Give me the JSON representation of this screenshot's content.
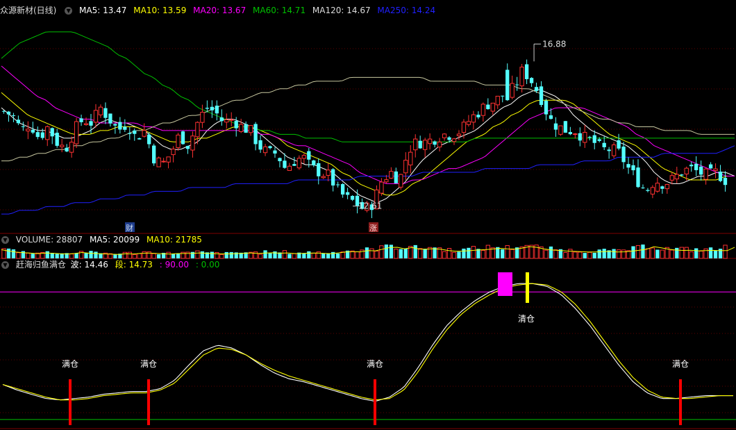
{
  "main_header": {
    "stock": "众源新材(日线)",
    "ma5": "MA5: 13.47",
    "ma10": "MA10: 13.59",
    "ma20": "MA20: 13.67",
    "ma60": "MA60: 14.71",
    "ma120": "MA120: 14.67",
    "ma250": "MA250: 14.24"
  },
  "vol_header": {
    "volume": "VOLUME: 28807",
    "ma5": "MA5: 20099",
    "ma10": "MA10: 21785"
  },
  "ind_header": {
    "name": "赶海归鱼满仓",
    "wave": "波: 14.46",
    "seg": "段: 14.73",
    "v90": ": 90.00",
    "v0": ": 0.00"
  },
  "colors": {
    "bg": "#000000",
    "up": "#ff3232",
    "down": "#54ffff",
    "ma5": "#ffffff",
    "ma10": "#ffff00",
    "ma20": "#ff00ff",
    "ma60": "#00c000",
    "ma120": "#c8c8a0",
    "ma250": "#2020ff",
    "grid": "#800000"
  },
  "annotations": {
    "high": "16.88",
    "low": "12.61",
    "marker_cai": "财",
    "marker_zhang": "涨"
  },
  "chart_data": [
    {
      "type": "candlestick",
      "title": "众源新材(日线)",
      "ylim": [
        12.0,
        17.6
      ],
      "price_path": [
        15.1,
        15.0,
        14.6,
        14.8,
        14.4,
        14.7,
        14.3,
        14.1,
        14.6,
        14.9,
        14.8,
        15.2,
        14.9,
        14.6,
        14.8,
        14.4,
        14.6,
        13.9,
        13.7,
        14.0,
        14.5,
        14.2,
        14.8,
        15.2,
        15.1,
        14.8,
        14.9,
        14.7,
        14.6,
        14.2,
        14.0,
        14.0,
        13.6,
        13.8,
        13.9,
        13.6,
        13.5,
        13.4,
        13.0,
        12.8,
        12.7,
        12.5,
        12.7,
        13.3,
        13.5,
        13.3,
        14.1,
        14.3,
        14.3,
        14.4,
        14.5,
        14.5,
        14.6,
        14.9,
        15.1,
        15.3,
        15.4,
        15.6,
        15.7,
        16.2,
        15.9,
        15.5,
        14.9,
        14.7,
        14.6,
        14.6,
        14.4,
        14.3,
        14.1,
        14.1,
        14.0,
        13.6,
        13.3,
        13.0,
        13.3,
        13.2,
        13.3,
        13.5,
        13.6,
        13.5,
        13.4,
        13.5,
        13.3
      ],
      "high": 16.88,
      "low": 12.61,
      "ma_series": [
        {
          "name": "MA5",
          "values": [
            15.2,
            15.0,
            14.8,
            14.7,
            14.6,
            14.6,
            14.5,
            14.4,
            14.4,
            14.5,
            14.6,
            14.8,
            14.9,
            14.8,
            14.8,
            14.7,
            14.6,
            14.4,
            14.2,
            14.1,
            14.1,
            14.2,
            14.3,
            14.6,
            14.8,
            14.9,
            14.9,
            14.8,
            14.7,
            14.5,
            14.3,
            14.1,
            13.9,
            13.8,
            13.7,
            13.7,
            13.6,
            13.5,
            13.3,
            13.1,
            12.9,
            12.8,
            12.7,
            12.8,
            13.0,
            13.2,
            13.5,
            13.8,
            14.0,
            14.2,
            14.3,
            14.4,
            14.5,
            14.6,
            14.8,
            15.0,
            15.2,
            15.3,
            15.5,
            15.6,
            15.7,
            15.6,
            15.5,
            15.3,
            15.0,
            14.8,
            14.6,
            14.5,
            14.4,
            14.3,
            14.2,
            14.0,
            13.8,
            13.5,
            13.3,
            13.2,
            13.2,
            13.3,
            13.4,
            13.4,
            13.5,
            13.5,
            13.4
          ]
        },
        {
          "name": "MA10",
          "values": [
            15.6,
            15.4,
            15.2,
            15.0,
            14.9,
            14.8,
            14.7,
            14.6,
            14.5,
            14.5,
            14.5,
            14.6,
            14.6,
            14.7,
            14.7,
            14.7,
            14.6,
            14.5,
            14.4,
            14.3,
            14.3,
            14.3,
            14.4,
            14.4,
            14.5,
            14.6,
            14.7,
            14.7,
            14.7,
            14.6,
            14.5,
            14.4,
            14.2,
            14.1,
            14.0,
            13.9,
            13.8,
            13.7,
            13.5,
            13.4,
            13.2,
            13.1,
            13.0,
            12.9,
            12.9,
            13.0,
            13.2,
            13.3,
            13.5,
            13.7,
            13.9,
            14.1,
            14.3,
            14.4,
            14.5,
            14.7,
            14.8,
            15.0,
            15.1,
            15.3,
            15.4,
            15.4,
            15.4,
            15.4,
            15.3,
            15.1,
            14.9,
            14.7,
            14.5,
            14.4,
            14.3,
            14.2,
            14.0,
            13.8,
            13.6,
            13.5,
            13.4,
            13.3,
            13.3,
            13.3,
            13.3,
            13.4,
            13.4
          ]
        },
        {
          "name": "MA20",
          "values": [
            16.3,
            16.1,
            15.9,
            15.7,
            15.5,
            15.4,
            15.2,
            15.1,
            15.0,
            14.9,
            14.9,
            14.8,
            14.8,
            14.8,
            14.8,
            14.8,
            14.7,
            14.7,
            14.6,
            14.6,
            14.6,
            14.6,
            14.6,
            14.6,
            14.6,
            14.6,
            14.6,
            14.6,
            14.6,
            14.5,
            14.5,
            14.4,
            14.3,
            14.2,
            14.2,
            14.1,
            14.0,
            13.9,
            13.8,
            13.7,
            13.5,
            13.4,
            13.3,
            13.2,
            13.2,
            13.2,
            13.3,
            13.3,
            13.4,
            13.5,
            13.6,
            13.6,
            13.7,
            13.8,
            13.9,
            14.1,
            14.3,
            14.5,
            14.7,
            14.9,
            15.0,
            15.1,
            15.2,
            15.2,
            15.2,
            15.2,
            15.1,
            15.0,
            14.9,
            14.8,
            14.7,
            14.5,
            14.4,
            14.2,
            14.1,
            14.0,
            13.9,
            13.8,
            13.7,
            13.6,
            13.5,
            13.4,
            13.4
          ]
        },
        {
          "name": "MA60",
          "values": [
            16.5,
            16.7,
            16.9,
            17.0,
            17.1,
            17.2,
            17.2,
            17.2,
            17.2,
            17.1,
            17.0,
            16.9,
            16.8,
            16.6,
            16.5,
            16.3,
            16.1,
            16.0,
            15.8,
            15.7,
            15.5,
            15.4,
            15.2,
            15.1,
            15.0,
            14.9,
            14.8,
            14.7,
            14.7,
            14.6,
            14.6,
            14.5,
            14.5,
            14.5,
            14.4,
            14.4,
            14.4,
            14.4,
            14.3,
            14.3,
            14.3,
            14.3,
            14.3,
            14.3,
            14.3,
            14.3,
            14.3,
            14.3,
            14.3,
            14.3,
            14.3,
            14.3,
            14.3,
            14.4,
            14.4,
            14.4,
            14.4,
            14.4,
            14.4,
            14.4,
            14.4,
            14.4,
            14.4,
            14.4,
            14.4,
            14.4,
            14.4,
            14.4,
            14.4,
            14.4,
            14.4,
            14.4,
            14.4,
            14.4,
            14.4,
            14.4,
            14.4,
            14.4,
            14.4,
            14.4,
            14.4,
            14.4,
            14.4
          ]
        },
        {
          "name": "MA120",
          "values": [
            13.8,
            13.8,
            13.9,
            13.9,
            14.0,
            14.0,
            14.1,
            14.1,
            14.2,
            14.2,
            14.3,
            14.3,
            14.4,
            14.4,
            14.5,
            14.6,
            14.6,
            14.7,
            14.8,
            14.8,
            14.9,
            15.0,
            15.0,
            15.1,
            15.2,
            15.3,
            15.4,
            15.4,
            15.5,
            15.6,
            15.6,
            15.7,
            15.7,
            15.8,
            15.8,
            15.9,
            15.9,
            15.9,
            15.9,
            16.0,
            16.0,
            16.0,
            16.0,
            16.0,
            16.0,
            16.0,
            16.0,
            16.0,
            15.9,
            15.9,
            15.9,
            15.9,
            15.9,
            15.9,
            15.8,
            15.8,
            15.8,
            15.8,
            15.7,
            15.7,
            15.6,
            15.5,
            15.4,
            15.3,
            15.2,
            15.1,
            15.0,
            14.9,
            14.9,
            14.8,
            14.8,
            14.7,
            14.7,
            14.7,
            14.6,
            14.6,
            14.6,
            14.6,
            14.5,
            14.5,
            14.5,
            14.5,
            14.5
          ]
        },
        {
          "name": "MA250",
          "values": [
            12.4,
            12.4,
            12.5,
            12.5,
            12.5,
            12.6,
            12.6,
            12.6,
            12.7,
            12.7,
            12.7,
            12.8,
            12.8,
            12.8,
            12.9,
            12.9,
            12.9,
            13.0,
            13.0,
            13.0,
            13.0,
            13.1,
            13.1,
            13.1,
            13.1,
            13.1,
            13.2,
            13.2,
            13.2,
            13.2,
            13.2,
            13.2,
            13.2,
            13.3,
            13.3,
            13.3,
            13.3,
            13.3,
            13.3,
            13.3,
            13.4,
            13.4,
            13.4,
            13.4,
            13.4,
            13.4,
            13.4,
            13.5,
            13.5,
            13.5,
            13.5,
            13.5,
            13.5,
            13.5,
            13.6,
            13.6,
            13.6,
            13.6,
            13.6,
            13.6,
            13.7,
            13.7,
            13.7,
            13.7,
            13.7,
            13.8,
            13.8,
            13.8,
            13.8,
            13.9,
            13.9,
            13.9,
            13.9,
            13.9,
            14.0,
            14.0,
            14.0,
            14.0,
            14.0,
            14.0,
            14.0,
            14.1,
            14.2
          ]
        }
      ]
    },
    {
      "type": "bar",
      "title": "VOLUME",
      "values": [
        22,
        18,
        15,
        14,
        12,
        14,
        13,
        11,
        12,
        15,
        13,
        12,
        11,
        10,
        12,
        11,
        14,
        13,
        12,
        11,
        13,
        12,
        14,
        13,
        12,
        11,
        12,
        13,
        14,
        12,
        15,
        13,
        14,
        12,
        13,
        14,
        13,
        12,
        15,
        18,
        16,
        20,
        19,
        26,
        30,
        24,
        28,
        22,
        25,
        24,
        20,
        18,
        19,
        21,
        22,
        24,
        26,
        23,
        25,
        30,
        28,
        22,
        21,
        19,
        18,
        17,
        16,
        17,
        18,
        16,
        17,
        20,
        22,
        30,
        26,
        22,
        20,
        21,
        19,
        20,
        21,
        18,
        28
      ]
    },
    {
      "type": "line",
      "title": "赶海归鱼满仓",
      "ylim": [
        -5,
        105
      ],
      "series": [
        {
          "name": "波",
          "values": [
            24,
            20,
            17,
            14,
            13,
            14,
            15,
            17,
            18,
            19,
            19,
            21,
            27,
            38,
            48,
            52,
            50,
            45,
            38,
            32,
            28,
            26,
            23,
            20,
            17,
            14,
            12,
            15,
            22,
            36,
            52,
            66,
            76,
            84,
            90,
            94,
            96,
            96,
            94,
            88,
            78,
            66,
            52,
            38,
            26,
            18,
            14,
            14,
            15,
            16,
            16,
            16
          ]
        },
        {
          "name": "段",
          "values": [
            24,
            21,
            18,
            15,
            13,
            13,
            14,
            16,
            17,
            18,
            18,
            20,
            25,
            35,
            45,
            50,
            49,
            45,
            39,
            34,
            30,
            27,
            24,
            21,
            18,
            15,
            13,
            14,
            20,
            33,
            49,
            63,
            74,
            82,
            88,
            93,
            95,
            96,
            95,
            90,
            81,
            69,
            55,
            41,
            29,
            20,
            15,
            14,
            14,
            15,
            16,
            16
          ]
        }
      ],
      "levels": [
        90,
        0
      ],
      "signals": [
        {
          "label": "满仓",
          "index": 1
        },
        {
          "label": "满仓",
          "index": 4
        },
        {
          "label": "满仓",
          "index": 14
        },
        {
          "label": "满仓",
          "index": 26
        },
        {
          "label": "清仓",
          "index": 22
        }
      ]
    }
  ]
}
